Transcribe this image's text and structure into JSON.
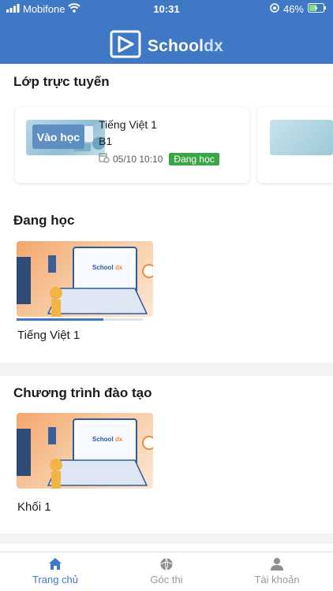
{
  "status_bar": {
    "carrier": "Mobifone",
    "time": "10:31",
    "battery": "46%"
  },
  "header": {
    "brand_main": "School",
    "brand_accent": "dx"
  },
  "live_section": {
    "title": "Lớp trực tuyến",
    "card": {
      "join_label": "Vào học",
      "subject": "Tiếng Việt 1",
      "class_name": "B1",
      "datetime": "05/10 10:10",
      "status_badge": "Đang học"
    }
  },
  "learning_section": {
    "title": "Đang học",
    "courses": [
      {
        "name": "Tiếng Việt 1",
        "progress": 0.69
      }
    ]
  },
  "program_section": {
    "title": "Chương trình đào tạo",
    "programs": [
      {
        "name": "Khối 1"
      }
    ]
  },
  "tabbar": {
    "tabs": [
      {
        "label": "Trang chủ",
        "icon": "home-icon",
        "active": true
      },
      {
        "label": "Góc thi",
        "icon": "globe-icon",
        "active": false
      },
      {
        "label": "Tài khoản",
        "icon": "user-icon",
        "active": false
      }
    ]
  },
  "colors": {
    "primary": "#3f79c6",
    "badge_green": "#3ba648"
  }
}
